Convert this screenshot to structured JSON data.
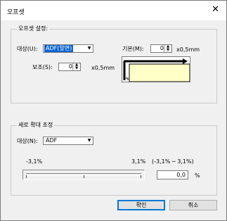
{
  "window": {
    "title": "오프셋",
    "close_glyph": "✕"
  },
  "offset_group": {
    "label": "오프셋 설정:",
    "target_label": "대상(U):",
    "target_value": "ADF(앞면)",
    "base_label": "기본(M):",
    "base_value": "0",
    "base_unit": "x0,5mm",
    "aux_label": "보조(S):",
    "aux_value": "0",
    "aux_unit": "x0,5mm"
  },
  "scale_group": {
    "label": "세로 확대 조정",
    "target_label": "대상(N):",
    "target_value": "ADF",
    "min_text": "-3,1%",
    "max_text": "3,1%",
    "range_text": "(-3,1% ─ 3,1%)",
    "value": "0,0",
    "unit": "%",
    "slider_fraction": 0.5
  },
  "buttons": {
    "ok": "확인",
    "cancel": "취소"
  },
  "colors": {
    "accent": "#0a64d2",
    "preview_fill": "#ffffc8",
    "preview_black": "#000000"
  }
}
